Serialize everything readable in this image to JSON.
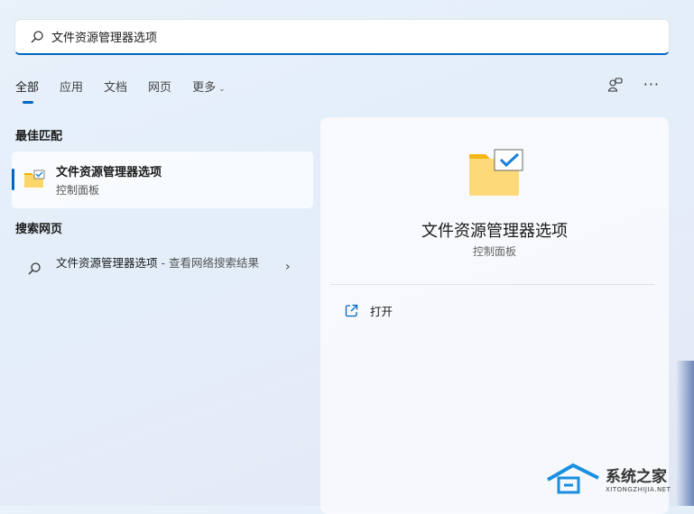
{
  "search": {
    "value": "文件资源管理器选项"
  },
  "tabs": [
    {
      "label": "全部"
    },
    {
      "label": "应用"
    },
    {
      "label": "文档"
    },
    {
      "label": "网页"
    },
    {
      "label": "更多"
    }
  ],
  "sections": {
    "best": "最佳匹配",
    "web": "搜索网页"
  },
  "best_match": {
    "title": "文件资源管理器选项",
    "subtitle": "控制面板"
  },
  "web_result": {
    "title": "文件资源管理器选项",
    "suffix": " - 查看网络搜索结果"
  },
  "preview": {
    "title": "文件资源管理器选项",
    "subtitle": "控制面板",
    "open_label": "打开"
  },
  "watermark": {
    "name": "系统之家",
    "url": "XITONGZHIJIA.NET"
  },
  "colors": {
    "accent": "#0067c0"
  }
}
